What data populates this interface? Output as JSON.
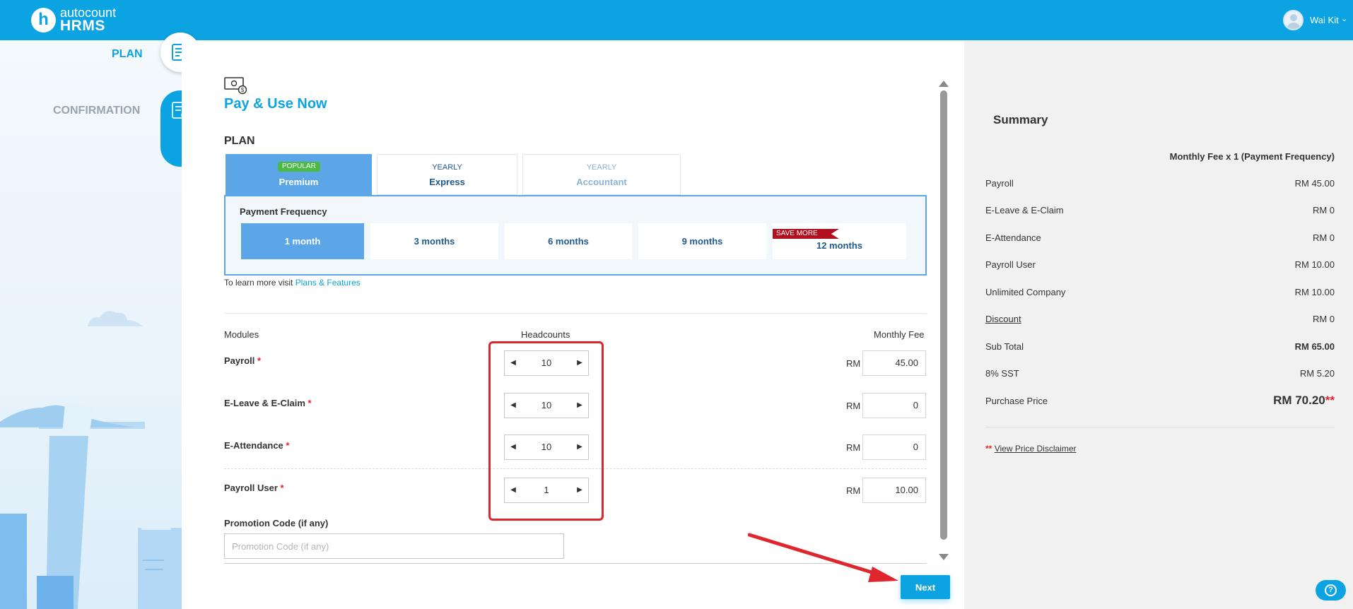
{
  "brand": {
    "line1": "autocount",
    "line2": "HRMS",
    "mark": "h"
  },
  "user": {
    "name": "Wai Kit",
    "chevron": "⌄"
  },
  "steps": [
    {
      "label": "PLAN",
      "state": "active"
    },
    {
      "label": "CONFIRMATION",
      "state": "pending"
    }
  ],
  "page": {
    "title": "Pay & Use Now",
    "plan_heading": "PLAN"
  },
  "plans": [
    {
      "badge": "POPULAR",
      "name": "Premium",
      "selected": true
    },
    {
      "sub": "YEARLY",
      "name": "Express",
      "selected": false
    },
    {
      "sub": "YEARLY",
      "name": "Accountant",
      "selected": false,
      "disabled": true
    }
  ],
  "payment_frequency": {
    "title": "Payment Frequency",
    "options": [
      "1 month",
      "3 months",
      "6 months",
      "9 months",
      "12 months"
    ],
    "selected": "1 month",
    "save_tag": "SAVE MORE"
  },
  "learn_more": {
    "text": "To learn more visit",
    "link": "Plans & Features"
  },
  "modules_table": {
    "headers": {
      "modules": "Modules",
      "headcounts": "Headcounts",
      "fee": "Monthly Fee"
    },
    "currency": "RM",
    "rows": [
      {
        "name": "Payroll",
        "required": "*",
        "headcount": "10",
        "fee": "45.00"
      },
      {
        "name": "E-Leave & E-Claim",
        "required": "*",
        "headcount": "10",
        "fee": "0"
      },
      {
        "name": "E-Attendance",
        "required": "*",
        "headcount": "10",
        "fee": "0"
      },
      {
        "name": "Payroll User",
        "required": "*",
        "headcount": "1",
        "fee": "10.00"
      }
    ]
  },
  "promo": {
    "label": "Promotion Code (if any)",
    "placeholder": "Promotion Code (if any)",
    "value": ""
  },
  "next_label": "Next",
  "summary": {
    "title": "Summary",
    "frequency_label": "Monthly Fee x 1 (Payment Frequency)",
    "rows": [
      {
        "label": "Payroll",
        "value": "RM 45.00"
      },
      {
        "label": "E-Leave & E-Claim",
        "value": "RM 0"
      },
      {
        "label": "E-Attendance",
        "value": "RM 0"
      },
      {
        "label": "Payroll User",
        "value": "RM 10.00"
      },
      {
        "label": "Unlimited Company",
        "value": "RM 10.00"
      },
      {
        "label": "Discount",
        "value": "RM 0"
      },
      {
        "label": "Sub Total",
        "value": "RM 65.00"
      },
      {
        "label": "8% SST",
        "value": "RM 5.20"
      },
      {
        "label": "Purchase Price",
        "value": "RM 70.20",
        "suffix": "**"
      }
    ],
    "disclaimer": {
      "stars": "**",
      "link": "View Price Disclaimer"
    }
  },
  "help_label": "?",
  "colors": {
    "brand": "#0ca3e2",
    "selected_tab": "#5ca6e8",
    "required": "#e0262d",
    "save_tag": "#b0101d",
    "popular": "#4cb944"
  }
}
